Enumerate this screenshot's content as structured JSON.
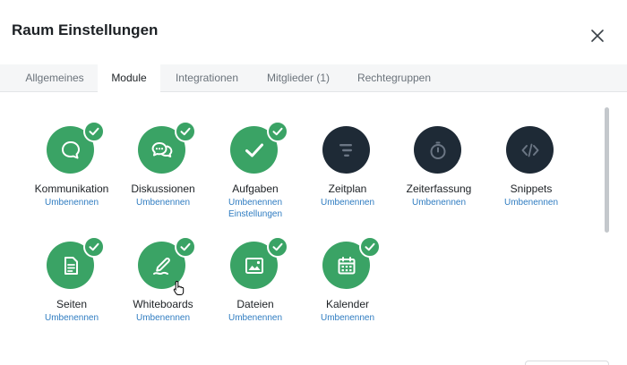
{
  "dialog": {
    "title": "Raum Einstellungen"
  },
  "tabs": [
    {
      "label": "Allgemeines"
    },
    {
      "label": "Module"
    },
    {
      "label": "Integrationen"
    },
    {
      "label": "Mitglieder (1)"
    },
    {
      "label": "Rechtegruppen"
    }
  ],
  "active_tab": "Module",
  "modules": [
    {
      "name": "Kommunikation",
      "enabled": true,
      "icon": "chat-bubble-icon",
      "links": [
        "Umbenennen"
      ]
    },
    {
      "name": "Diskussionen",
      "enabled": true,
      "icon": "discussion-icon",
      "links": [
        "Umbenennen"
      ]
    },
    {
      "name": "Aufgaben",
      "enabled": true,
      "icon": "checkmark-icon",
      "links": [
        "Umbenennen",
        "Einstellungen"
      ]
    },
    {
      "name": "Zeitplan",
      "enabled": false,
      "icon": "timeline-icon",
      "links": [
        "Umbenennen"
      ]
    },
    {
      "name": "Zeiterfassung",
      "enabled": false,
      "icon": "stopwatch-icon",
      "links": [
        "Umbenennen"
      ]
    },
    {
      "name": "Snippets",
      "enabled": false,
      "icon": "code-icon",
      "links": [
        "Umbenennen"
      ]
    },
    {
      "name": "Seiten",
      "enabled": true,
      "icon": "document-icon",
      "links": [
        "Umbenennen"
      ]
    },
    {
      "name": "Whiteboards",
      "enabled": true,
      "icon": "pen-icon",
      "links": [
        "Umbenennen"
      ]
    },
    {
      "name": "Dateien",
      "enabled": true,
      "icon": "image-icon",
      "links": [
        "Umbenennen"
      ]
    },
    {
      "name": "Kalender",
      "enabled": true,
      "icon": "calendar-icon",
      "links": [
        "Umbenennen"
      ]
    }
  ],
  "colors": {
    "enabled": "#3aa365",
    "disabled": "#1e2a36",
    "link": "#2f7cc1"
  }
}
